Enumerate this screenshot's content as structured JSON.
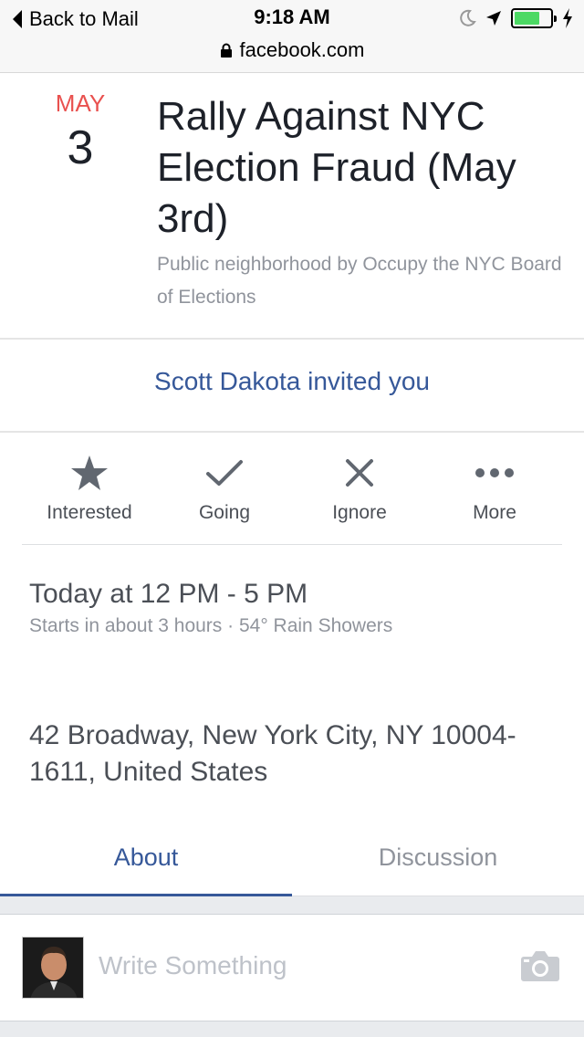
{
  "status_bar": {
    "back_label": "Back to Mail",
    "time": "9:18 AM",
    "url": "facebook.com"
  },
  "event": {
    "month": "MAY",
    "day": "3",
    "title": "Rally Against NYC Election Fraud (May 3rd)",
    "subtitle": "Public neighborhood by Occupy the NYC Board of Elections"
  },
  "invite": {
    "text": "Scott Dakota invited you"
  },
  "actions": [
    {
      "label": "Interested",
      "icon": "star-icon"
    },
    {
      "label": "Going",
      "icon": "check-icon"
    },
    {
      "label": "Ignore",
      "icon": "x-icon"
    },
    {
      "label": "More",
      "icon": "ellipsis-icon"
    }
  ],
  "details": {
    "when": "Today at 12 PM - 5 PM",
    "when_sub": "Starts in about 3 hours · 54° Rain Showers",
    "where": "42 Broadway, New York City, NY 10004-1611, United States"
  },
  "tabs": [
    {
      "label": "About",
      "active": true
    },
    {
      "label": "Discussion",
      "active": false
    }
  ],
  "composer": {
    "placeholder": "Write Something"
  },
  "colors": {
    "accent": "#365899",
    "month": "#e9514f",
    "battery": "#4cd964"
  }
}
